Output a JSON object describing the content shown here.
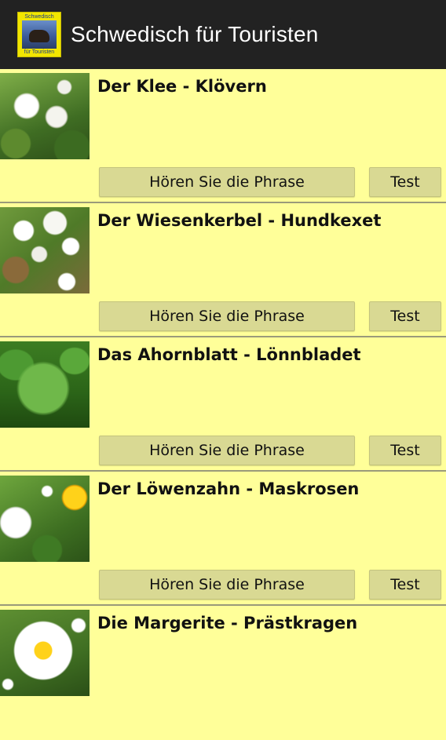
{
  "appbar": {
    "title": "Schwedisch für Touristen",
    "icon_text_top": "Schwedisch",
    "icon_text_bottom": "für Touristen"
  },
  "buttons": {
    "hear_label": "Hören Sie die Phrase",
    "test_label": "Test"
  },
  "items": [
    {
      "phrase": "Der Klee - Klövern",
      "image": "clover-photo"
    },
    {
      "phrase": "Der Wiesenkerbel - Hundkexet",
      "image": "cow-parsley-photo"
    },
    {
      "phrase": "Das Ahornblatt - Lönnbladet",
      "image": "maple-leaf-photo"
    },
    {
      "phrase": "Der Löwenzahn - Maskrosen",
      "image": "dandelion-photo"
    },
    {
      "phrase": "Die Margerite - Prästkragen",
      "image": "oxeye-daisy-photo"
    }
  ],
  "colors": {
    "background": "#ffff99",
    "appbar": "#222222",
    "button": "#d9d993",
    "app_icon": "#f2e600"
  }
}
